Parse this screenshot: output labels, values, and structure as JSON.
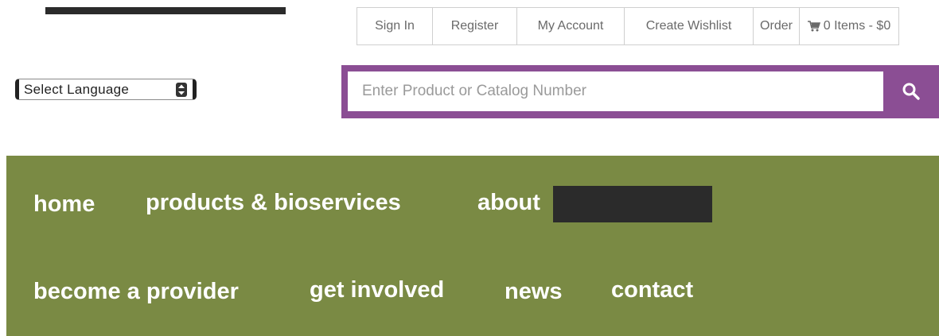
{
  "utility_links": {
    "sign_in": "Sign In",
    "register": "Register",
    "my_account": "My Account",
    "create_wishlist": "Create Wishlist",
    "order": "Order",
    "cart": "0 Items - $0"
  },
  "language": {
    "selected": "Select Language"
  },
  "search": {
    "placeholder": "Enter Product or Catalog Number",
    "value": ""
  },
  "nav": {
    "home": "home",
    "products": "products & bioservices",
    "about": "about",
    "become_provider": "become a provider",
    "get_involved": "get involved",
    "news": "news",
    "contact": "contact"
  },
  "icons": {
    "cart": "cart-icon",
    "search": "search-icon",
    "select_arrows": "select-arrows-icon"
  },
  "colors": {
    "search_accent": "#8b4e94",
    "nav_background": "#7a8a44",
    "nav_text": "#ffffff",
    "redaction": "#2b2b2b"
  }
}
